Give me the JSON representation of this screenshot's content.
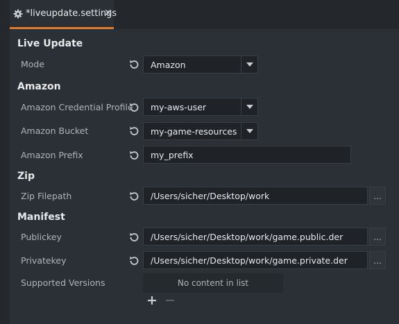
{
  "tab": {
    "title": "*liveupdate.settings",
    "close_glyph": "✕",
    "icon": "gear-icon"
  },
  "sections": {
    "live_update": "Live Update",
    "amazon": "Amazon",
    "zip": "Zip",
    "manifest": "Manifest"
  },
  "fields": {
    "mode": {
      "label": "Mode",
      "value": "Amazon"
    },
    "credential_profile": {
      "label": "Amazon Credential Profile",
      "value": "my-aws-user"
    },
    "bucket": {
      "label": "Amazon Bucket",
      "value": "my-game-resources"
    },
    "prefix": {
      "label": "Amazon Prefix",
      "value": "my_prefix"
    },
    "zip_filepath": {
      "label": "Zip Filepath",
      "value": "/Users/sicher/Desktop/work"
    },
    "publickey": {
      "label": "Publickey",
      "value": "/Users/sicher/Desktop/work/game.public.der"
    },
    "privatekey": {
      "label": "Privatekey",
      "value": "/Users/sicher/Desktop/work/game.private.der"
    },
    "supported_versions": {
      "label": "Supported Versions",
      "empty_text": "No content in list"
    }
  },
  "browse_label": "...",
  "colors": {
    "accent": "#e27a2b",
    "background": "#2b3036",
    "field": "#1f2327"
  }
}
